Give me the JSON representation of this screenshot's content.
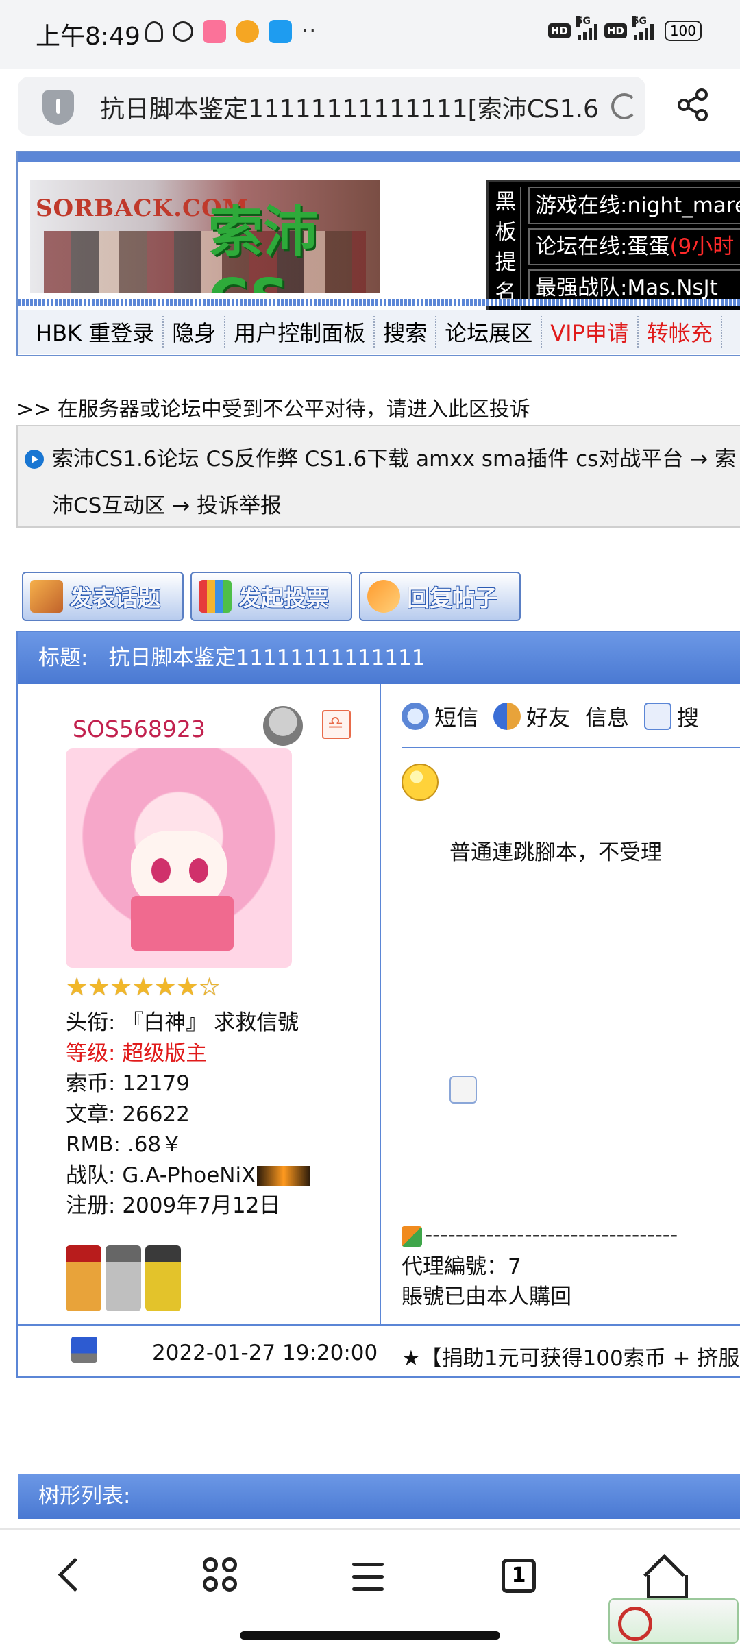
{
  "status_bar": {
    "time": "上午8:49",
    "more_dots": "··",
    "hd1": "HD",
    "net1": "5G",
    "hd2": "HD",
    "net2": "5G",
    "battery": "100"
  },
  "browser": {
    "url_title": "抗日脚本鉴定11111111111111[索沛CS1.6",
    "icons": [
      "shield-icon",
      "reload-icon",
      "share-icon"
    ]
  },
  "forum_header": {
    "logo_en": "SORBACK.COM",
    "logo_cn": "索沛CS",
    "board_label": "黑板提名",
    "board_rows": [
      {
        "prefix": "游戏在线:",
        "value": "night_mare",
        "suffix": ""
      },
      {
        "prefix": "论坛在线:",
        "value": "蛋蛋",
        "suffix": "(9小时"
      },
      {
        "prefix": "最强战队:",
        "value": "Mas.NsJt",
        "suffix": ""
      }
    ],
    "nav": [
      {
        "label": "HBK 重登录",
        "highlight": false
      },
      {
        "label": "隐身",
        "highlight": false
      },
      {
        "label": "用户控制面板",
        "highlight": false
      },
      {
        "label": "搜索",
        "highlight": false
      },
      {
        "label": "论坛展区",
        "highlight": false
      },
      {
        "label": "VIP申请",
        "highlight": true
      },
      {
        "label": "转帐充",
        "highlight": true
      }
    ]
  },
  "notice": ">> 在服务器或论坛中受到不公平对待，请进入此区投诉",
  "breadcrumb": "索沛CS1.6论坛 CS反作弊 CS1.6下载 amxx sma插件 cs对战平台 → 索沛CS互动区 → 投诉举报",
  "actions": [
    {
      "label": "发表话题",
      "icon": "pen-icon"
    },
    {
      "label": "发起投票",
      "icon": "poll-icon"
    },
    {
      "label": "回复帖子",
      "icon": "reply-icon"
    }
  ],
  "post": {
    "title_label": "标题:",
    "title": "抗日脚本鉴定11111111111111",
    "author": {
      "name": "SOS568923",
      "stars": "★★★★★★☆",
      "rank_label": "头衔:",
      "rank_value": "『白神』 求救信號",
      "level_label": "等级:",
      "level_value": "超级版主",
      "coins_label": "索币:",
      "coins_value": "12179",
      "posts_label": "文章:",
      "posts_value": "26622",
      "rmb_label": "RMB:",
      "rmb_value": ".68￥",
      "team_label": "战队:",
      "team_value": "G.A-PhoeNiX",
      "reg_label": "注册:",
      "reg_value": "2009年7月12日"
    },
    "tools": [
      {
        "label": "短信",
        "icon": "sms-icon"
      },
      {
        "label": "好友",
        "icon": "friends-icon"
      },
      {
        "label": "信息",
        "icon": "info-icon"
      },
      {
        "label": "搜",
        "icon": "search-icon"
      }
    ],
    "body": "普通連跳腳本，不受理",
    "signature_divider": "---------------------------------",
    "signature_lines": [
      "代理編號：7",
      "賬號已由本人購回"
    ],
    "time": "2022-01-27 19:20:00",
    "footer_note": "★【捐助1元可获得100索币 + 挤服"
  },
  "tree_list": {
    "title": "树形列表:"
  },
  "bottom_nav": {
    "tab_count": "1",
    "icons": [
      "back-icon",
      "apps-icon",
      "menu-icon",
      "tabs-icon",
      "home-icon"
    ]
  }
}
